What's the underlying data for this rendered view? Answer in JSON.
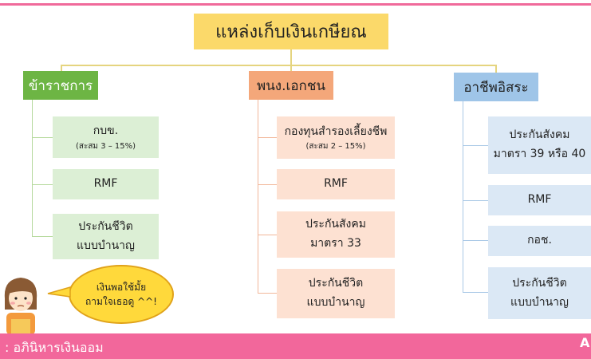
{
  "title": "แหล่งเก็บเงินเกษียณ",
  "categories": {
    "government": {
      "label": "ข้าราชการ",
      "items": [
        {
          "text": "กบข.",
          "note": "(สะสม 3 – 15%)"
        },
        {
          "text": "RMF"
        },
        {
          "line1": "ประกันชีวิต",
          "line2": "แบบบำนาญ"
        }
      ]
    },
    "private": {
      "label": "พนง.เอกชน",
      "items": [
        {
          "text": "กองทุนสำรองเลี้ยงชีพ",
          "note": "(สะสม 2 – 15%)"
        },
        {
          "text": "RMF"
        },
        {
          "line1": "ประกันสังคม",
          "line2": "มาตรา 33"
        },
        {
          "line1": "ประกันชีวิต",
          "line2": "แบบบำนาญ"
        }
      ]
    },
    "freelance": {
      "label": "อาชีพอิสระ",
      "items": [
        {
          "line1": "ประกันสังคม",
          "line2": "มาตรา 39 หรือ 40"
        },
        {
          "text": "RMF"
        },
        {
          "text": "กอช."
        },
        {
          "line1": "ประกันชีวิต",
          "line2": "แบบบำนาญ"
        }
      ]
    }
  },
  "bubble": {
    "line1": "เงินพอใช้มั้ย",
    "line2": "ถามใจเธอดู ^^!"
  },
  "footer": {
    "text": ": อภินิหารเงินออม",
    "logo": "A"
  },
  "colors": {
    "accent": "#f2679b",
    "title": "#fbd96a",
    "green": "#6db544",
    "orange": "#f4a77a",
    "blue": "#9fc5e8"
  }
}
